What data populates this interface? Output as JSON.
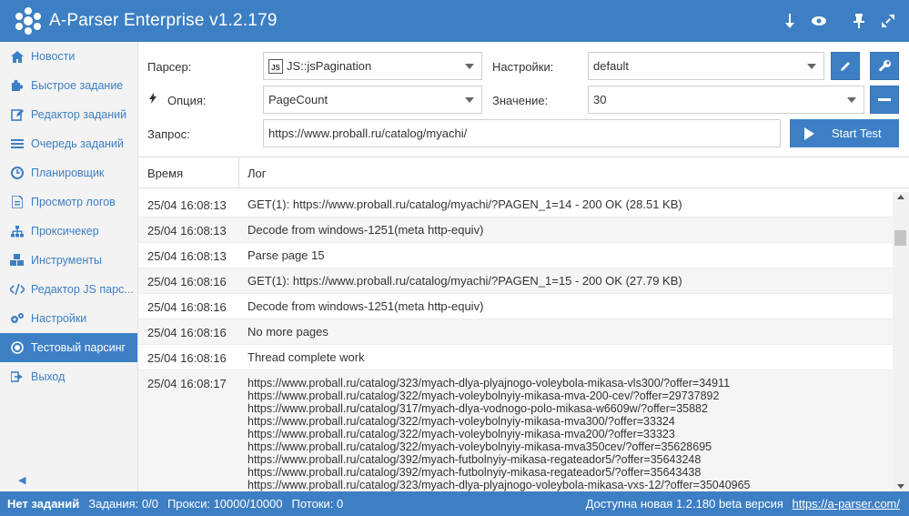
{
  "app": {
    "title": "A-Parser Enterprise v1.2.179"
  },
  "titlebar_icons": [
    "download-icon",
    "eye-icon",
    "pin-icon",
    "expand-icon"
  ],
  "sidebar": {
    "items": [
      {
        "label": "Новости",
        "icon": "home-icon"
      },
      {
        "label": "Быстрое задание",
        "icon": "puzzle-icon"
      },
      {
        "label": "Редактор заданий",
        "icon": "edit-icon"
      },
      {
        "label": "Очередь заданий",
        "icon": "list-icon"
      },
      {
        "label": "Планировщик",
        "icon": "clock-icon"
      },
      {
        "label": "Просмотр логов",
        "icon": "file-icon"
      },
      {
        "label": "Проксичекер",
        "icon": "sitemap-icon"
      },
      {
        "label": "Инструменты",
        "icon": "cubes-icon"
      },
      {
        "label": "Редактор JS парс...",
        "icon": "code-icon"
      },
      {
        "label": "Настройки",
        "icon": "cogs-icon"
      },
      {
        "label": "Тестовый парсинг",
        "icon": "target-icon",
        "active": true
      },
      {
        "label": "Выход",
        "icon": "sign-out-icon"
      }
    ],
    "collapse_glyph": "◀"
  },
  "form": {
    "parser_label": "Парсер:",
    "parser_badge": "JS",
    "parser_value": "JS::jsPagination",
    "settings_label": "Настройки:",
    "settings_value": "default",
    "option_label": "Опция:",
    "option_value": "PageCount",
    "value_label": "Значение:",
    "value_value": "30",
    "query_label": "Запрос:",
    "query_value": "https://www.proball.ru/catalog/myachi/",
    "start_label": "Start Test"
  },
  "log": {
    "col_time": "Время",
    "col_log": "Лог",
    "rows": [
      {
        "time": "25/04 16:08:13",
        "msg": "GET(1): https://www.proball.ru/catalog/myachi/?PAGEN_1=14 - 200 OK (28.51 KB)"
      },
      {
        "time": "25/04 16:08:13",
        "msg": "Decode from windows-1251(meta http-equiv)"
      },
      {
        "time": "25/04 16:08:13",
        "msg": "Parse page 15"
      },
      {
        "time": "25/04 16:08:16",
        "msg": "GET(1): https://www.proball.ru/catalog/myachi/?PAGEN_1=15 - 200 OK (27.79 KB)"
      },
      {
        "time": "25/04 16:08:16",
        "msg": "Decode from windows-1251(meta http-equiv)"
      },
      {
        "time": "25/04 16:08:16",
        "msg": "No more pages"
      },
      {
        "time": "25/04 16:08:16",
        "msg": "Thread complete work"
      }
    ],
    "url_row": {
      "time": "25/04 16:08:17",
      "urls": [
        "https://www.proball.ru/catalog/323/myach-dlya-plyajnogo-voleybola-mikasa-vls300/?offer=34911",
        "https://www.proball.ru/catalog/322/myach-voleybolnyiy-mikasa-mva-200-cev/?offer=29737892",
        "https://www.proball.ru/catalog/317/myach-dlya-vodnogo-polo-mikasa-w6609w/?offer=35882",
        "https://www.proball.ru/catalog/322/myach-voleybolnyiy-mikasa-mva300/?offer=33324",
        "https://www.proball.ru/catalog/322/myach-voleybolnyiy-mikasa-mva200/?offer=33323",
        "https://www.proball.ru/catalog/322/myach-voleybolnyiy-mikasa-mva350cev/?offer=35628695",
        "https://www.proball.ru/catalog/392/myach-futbolnyiy-mikasa-regateador5/?offer=35643248",
        "https://www.proball.ru/catalog/392/myach-futbolnyiy-mikasa-regateador5/?offer=35643438",
        "https://www.proball.ru/catalog/323/myach-dlya-plyajnogo-voleybola-mikasa-vxs-12/?offer=35040965"
      ]
    }
  },
  "status": {
    "no_tasks": "Нет заданий",
    "tasks": "Задания: 0/0",
    "proxies": "Прокси: 10000/10000",
    "threads": "Потоки: 0",
    "update_text": "Доступна новая 1.2.180 beta версия",
    "update_link": "https://a-parser.com/"
  },
  "colors": {
    "accent": "#3d7fc4",
    "sidebar_bg": "#f3f3f3",
    "row_alt": "#f5f5f5"
  }
}
